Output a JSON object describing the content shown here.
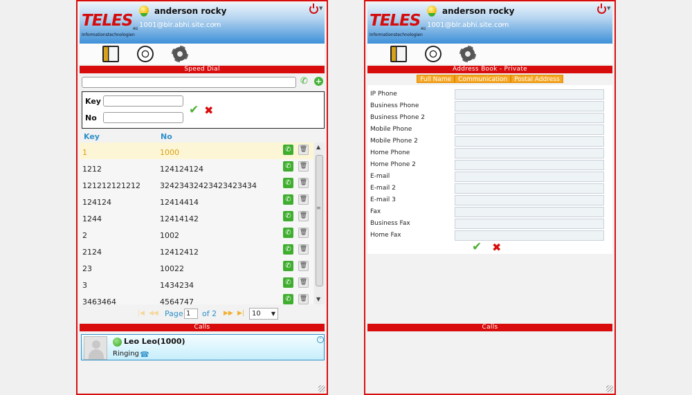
{
  "user": {
    "name": "anderson rocky",
    "email": "1001@blr.abhi.site.com"
  },
  "logo": {
    "text": "TELES",
    "subtitle": "Informationstechnologien",
    "suffix": "AG"
  },
  "icons": {
    "status": "presence-bulb-icon",
    "power": "power-icon",
    "address_book": "address-book-icon",
    "dialpad": "rotary-dial-icon",
    "settings": "gear-icon",
    "call": "phone-icon",
    "delete": "trash-icon",
    "add": "plus-icon"
  },
  "colors": {
    "brand_red": "#d80c0c",
    "header_blue": "#3d90d8",
    "accent_orange": "#f5a623",
    "call_green": "#3fae2f"
  },
  "speed_dial": {
    "title": "Speed Dial",
    "search_value": "",
    "key_label": "Key",
    "no_label": "No",
    "key_value": "",
    "no_value": "",
    "columns": {
      "key": "Key",
      "no": "No"
    },
    "rows": [
      {
        "key": "1",
        "no": "1000",
        "selected": true
      },
      {
        "key": "1212",
        "no": "124124124",
        "selected": false
      },
      {
        "key": "121212121212",
        "no": "32423432423423423434",
        "selected": false
      },
      {
        "key": "124124",
        "no": "12414414",
        "selected": false
      },
      {
        "key": "1244",
        "no": "12414142",
        "selected": false
      },
      {
        "key": "2",
        "no": "1002",
        "selected": false
      },
      {
        "key": "2124",
        "no": "12412412",
        "selected": false
      },
      {
        "key": "23",
        "no": "10022",
        "selected": false
      },
      {
        "key": "3",
        "no": "1434234",
        "selected": false
      },
      {
        "key": "3463464",
        "no": "4564747",
        "selected": false
      }
    ],
    "pager": {
      "page_label": "Page",
      "page_value": "1",
      "of_label": "of 2",
      "page_size": "10"
    }
  },
  "calls": {
    "title": "Calls",
    "active_call": {
      "name": "Leo Leo(1000)",
      "state": "Ringing"
    }
  },
  "address_book": {
    "title": "Address Book - Private",
    "tabs": [
      "Full Name",
      "Communication",
      "Postal Address"
    ],
    "fields": [
      {
        "label": "IP Phone",
        "value": ""
      },
      {
        "label": "Business Phone",
        "value": ""
      },
      {
        "label": "Business Phone 2",
        "value": ""
      },
      {
        "label": "Mobile Phone",
        "value": ""
      },
      {
        "label": "Mobile Phone 2",
        "value": ""
      },
      {
        "label": "Home Phone",
        "value": ""
      },
      {
        "label": "Home Phone 2",
        "value": ""
      },
      {
        "label": "E-mail",
        "value": ""
      },
      {
        "label": "E-mail 2",
        "value": ""
      },
      {
        "label": "E-mail 3",
        "value": ""
      },
      {
        "label": "Fax",
        "value": ""
      },
      {
        "label": "Business Fax",
        "value": ""
      },
      {
        "label": "Home Fax",
        "value": ""
      }
    ]
  }
}
